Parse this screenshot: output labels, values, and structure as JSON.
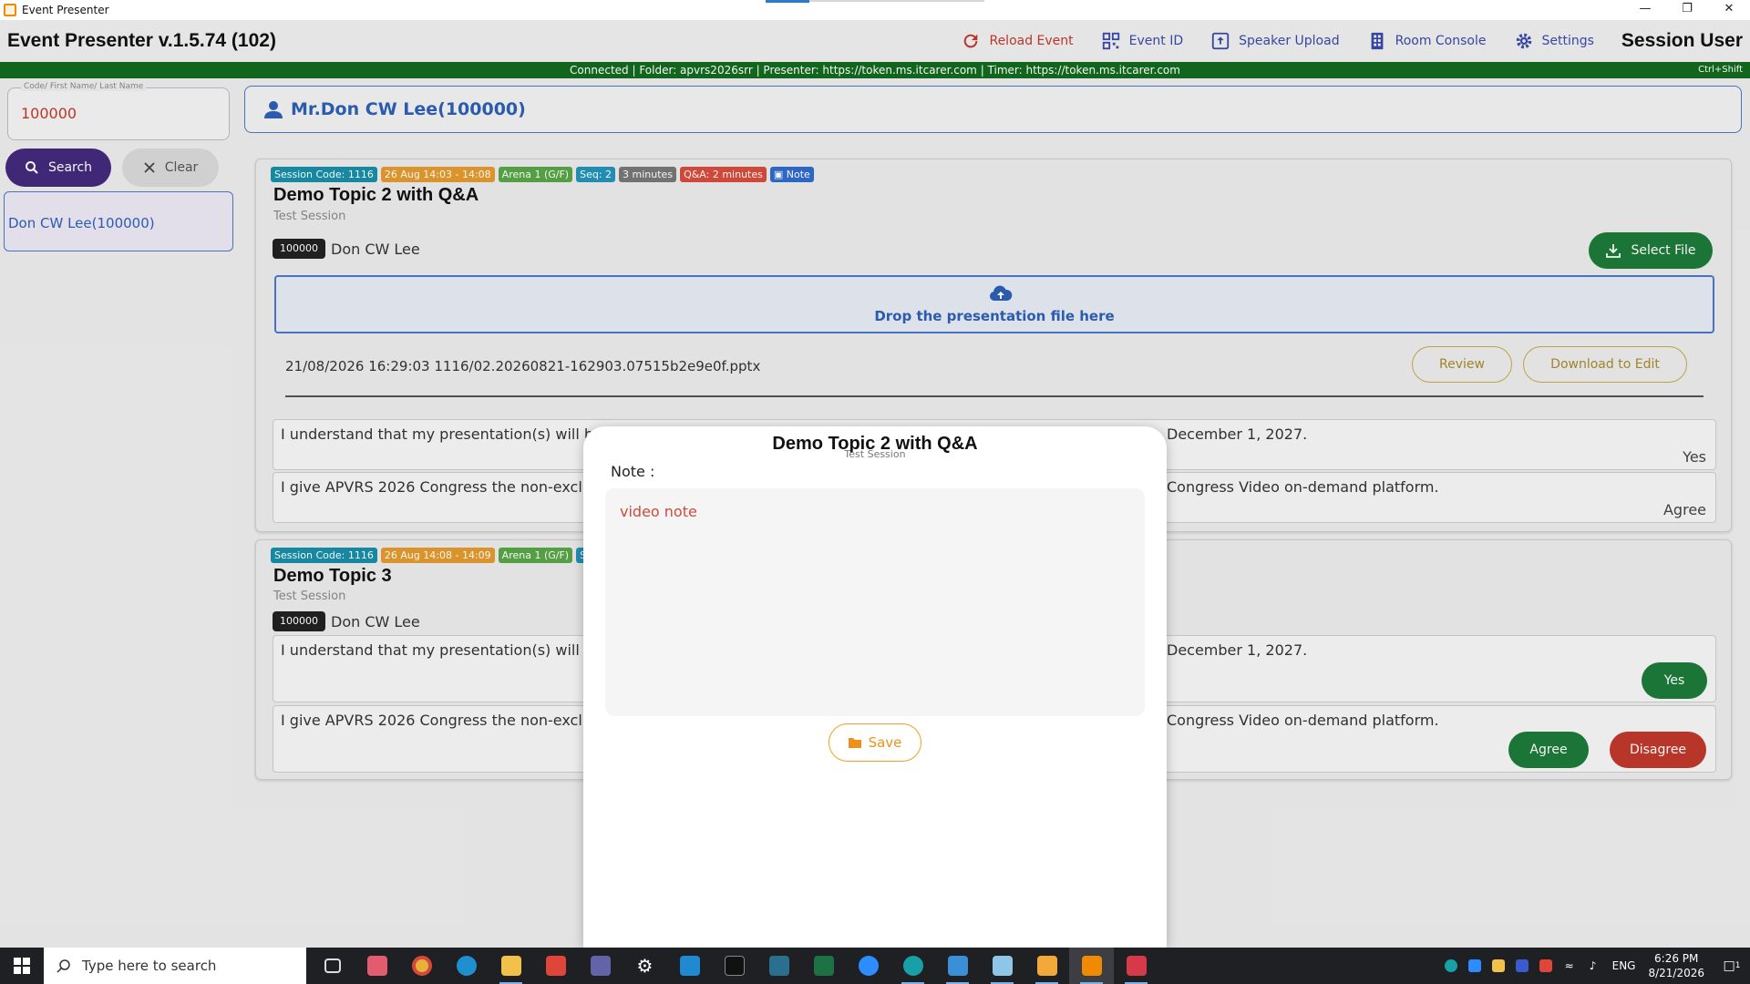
{
  "window": {
    "title": "Event Presenter"
  },
  "header": {
    "app_title": "Event Presenter v.1.5.74 (102)",
    "reload": "Reload Event",
    "event_id": "Event ID",
    "speaker_upload": "Speaker Upload",
    "room_console": "Room Console",
    "settings": "Settings",
    "session_user": "Session User"
  },
  "statusbar": {
    "text": "Connected | Folder: apvrs2026srr | Presenter: https://token.ms.itcarer.com | Timer: https://token.ms.itcarer.com",
    "shortcut": "Ctrl+Shift"
  },
  "search": {
    "legend": "Code/ First Name/ Last Name",
    "value": "100000",
    "search_label": "Search",
    "clear_label": "Clear",
    "result": "Don CW Lee(100000)"
  },
  "speaker": {
    "name": "Mr.Don CW Lee(100000)"
  },
  "sessions": [
    {
      "tags": {
        "code": "Session Code: 1116",
        "time": "26 Aug 14:03 - 14:08",
        "arena": "Arena 1 (G/F)",
        "seq": "Seq: 2",
        "duration": "3 minutes",
        "qa": "Q&A: 2 minutes",
        "note": "Note"
      },
      "title": "Demo Topic 2 with Q&A",
      "subtitle": "Test Session",
      "speaker_id": "100000",
      "speaker_name": "Don CW Lee",
      "select_file": "Select File",
      "drop_text": "Drop the presentation file here",
      "file": "21/08/2026 16:29:03 1116/02.20260821-162903.07515b2e9e0f.pptx",
      "review": "Review",
      "download": "Download to Edit",
      "consent1_left": "I understand that my presentation(s) will be re",
      "consent1_right": "December 1, 2027.",
      "consent1_answer": "Yes",
      "consent2_left": "I give APVRS 2026 Congress the non-exclusive",
      "consent2_right": "Congress Video on-demand platform.",
      "consent2_answer": "Agree"
    },
    {
      "tags": {
        "code": "Session Code: 1116",
        "time": "26 Aug 14:08 - 14:09",
        "arena": "Arena 1 (G/F)",
        "seq": "Seq:"
      },
      "title": "Demo Topic 3",
      "subtitle": "Test Session",
      "speaker_id": "100000",
      "speaker_name": "Don CW Lee",
      "consent1_left": "I understand that my presentation(s) will be re",
      "consent1_right": "December 1, 2027.",
      "yes": "Yes",
      "consent2_left": "I give APVRS 2026 Congress the non-exclusive",
      "consent2_right": "Congress Video on-demand platform.",
      "agree": "Agree",
      "disagree": "Disagree"
    }
  ],
  "modal": {
    "title": "Demo Topic 2 with Q&A",
    "subtitle": "Test Session",
    "note_label": "Note :",
    "note_value": "video note",
    "save": "Save"
  },
  "taskbar": {
    "search_placeholder": "Type here to search",
    "lang": "ENG",
    "time": "6:26 PM",
    "date": "8/21/2026",
    "notification_count": "1"
  },
  "colors": {
    "accent_blue": "#2d5fb4",
    "status_green": "#136a1e",
    "search_purple": "#442a7c",
    "danger_red": "#c0392b"
  }
}
